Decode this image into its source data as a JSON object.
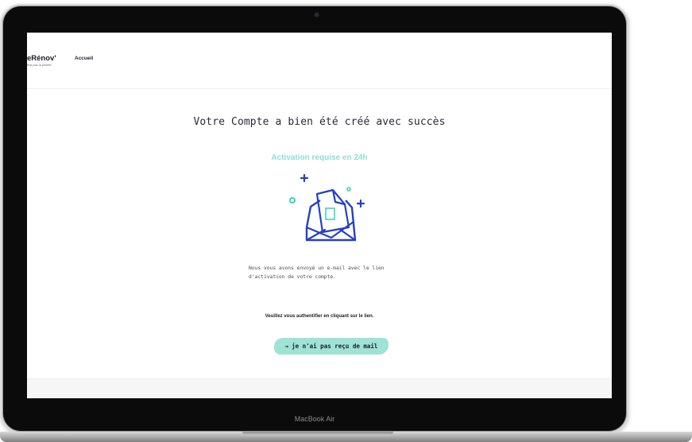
{
  "header": {
    "logo_title": "eRénov'",
    "logo_tagline": "ieux pour la planète",
    "nav": [
      "Accueil"
    ]
  },
  "main": {
    "title": "Votre Compte a bien été créé avec succès",
    "status": "Activation requise en 24h",
    "illustration_icon": "mail-envelope-icon",
    "message": "Nous vous avons envoyé un e-mail avec le lien d'activation de votre compte.",
    "instruction": "Veuillez vous authentifier en cliquant sur le lien.",
    "resend_arrow": "→",
    "resend_label": "je n'ai pas reçu de mail"
  },
  "device": {
    "label": "MacBook Air"
  },
  "colors": {
    "accent": "#9ee3d3",
    "accent_text": "#8fe0d0",
    "illustration_blue": "#2440c4",
    "illustration_teal": "#34d3b5",
    "text_dark": "#1b1b2f"
  }
}
